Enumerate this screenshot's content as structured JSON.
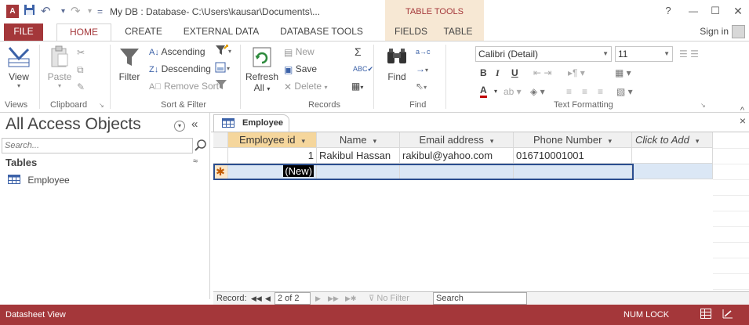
{
  "window": {
    "app_icon": "A",
    "title": "My DB : Database- C:\\Users\\kausar\\Documents\\...",
    "contextual_tools_label": "TABLE TOOLS",
    "help": "?",
    "minimize": "—",
    "restore": "☐",
    "close": "✕"
  },
  "qat": {
    "undo": "↶",
    "redo": "↷",
    "customize": "="
  },
  "tabs": [
    {
      "label": "FILE"
    },
    {
      "label": "HOME"
    },
    {
      "label": "CREATE"
    },
    {
      "label": "EXTERNAL DATA"
    },
    {
      "label": "DATABASE TOOLS"
    },
    {
      "label": "FIELDS"
    },
    {
      "label": "TABLE"
    }
  ],
  "signin": "Sign in",
  "ribbon": {
    "views": {
      "view": "View",
      "label": "Views"
    },
    "clipboard": {
      "paste": "Paste",
      "label": "Clipboard"
    },
    "sort_filter": {
      "filter": "Filter",
      "ascending": "Ascending",
      "descending": "Descending",
      "remove_sort": "Remove Sort",
      "label": "Sort & Filter"
    },
    "records": {
      "refresh": "Refresh",
      "refresh_all": "All",
      "new": "New",
      "save": "Save",
      "delete": "Delete",
      "label": "Records"
    },
    "find": {
      "find": "Find",
      "label": "Find"
    },
    "text_formatting": {
      "font": "Calibri (Detail)",
      "size": "11",
      "bold": "B",
      "italic": "I",
      "underline": "U",
      "font_color": "A",
      "label": "Text Formatting"
    },
    "collapse": "^"
  },
  "nav": {
    "title": "All Access Objects",
    "collapse": "«",
    "search_placeholder": "Search...",
    "group": "Tables",
    "group_chevron": "≈",
    "items": [
      {
        "label": "Employee"
      }
    ]
  },
  "document": {
    "tab_label": "Employee",
    "close": "×",
    "columns": [
      {
        "label": "Employee id"
      },
      {
        "label": "Name"
      },
      {
        "label": "Email address"
      },
      {
        "label": "Phone Number"
      },
      {
        "label": "Click to Add"
      }
    ],
    "rows": [
      {
        "id": "1",
        "name": "Rakibul Hassan",
        "email": "rakibul@yahoo.com",
        "phone": "016710001001"
      }
    ],
    "new_row": {
      "marker": "✱",
      "id": "(New)"
    }
  },
  "record_nav": {
    "record_label": "Record:",
    "first": "◀◀",
    "prev": "◀",
    "position": "2 of 2",
    "next": "▶",
    "last": "▶▶",
    "new": "▶✱",
    "no_filter": "No Filter",
    "search": "Search"
  },
  "status": {
    "view": "Datasheet View",
    "numlock": "NUM LOCK"
  },
  "colors": {
    "access_red": "#a4373a",
    "selected_header": "#f5d69c",
    "contextual_band": "#f7e8d4",
    "new_row": "#dbe7f5",
    "focus_border": "#2b4e8f"
  }
}
